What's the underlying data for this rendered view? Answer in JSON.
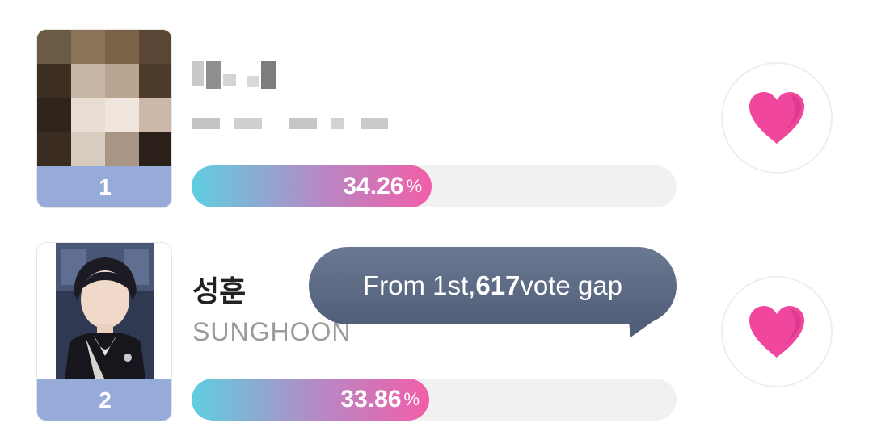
{
  "ranking": [
    {
      "rank": "1",
      "name_ko": "",
      "name_en": "",
      "vote_share": 34.26,
      "vote_share_label": "34.26",
      "percent_sign": "%",
      "name_obscured": true
    },
    {
      "rank": "2",
      "name_ko": "성훈",
      "name_en": "SUNGHOON",
      "vote_share": 33.86,
      "vote_share_label": "33.86",
      "percent_sign": "%",
      "name_obscured": false
    }
  ],
  "tooltip": {
    "prefix": "From 1st, ",
    "gap": "617",
    "suffix": " vote gap"
  },
  "colors": {
    "rank_strip": "#97abd9",
    "heart": "#f0479c",
    "tooltip_bg": "#5b6982",
    "bar_start": "#5ecfe0",
    "bar_end": "#f25ea8"
  },
  "icons": {
    "vote": "heart-icon"
  }
}
